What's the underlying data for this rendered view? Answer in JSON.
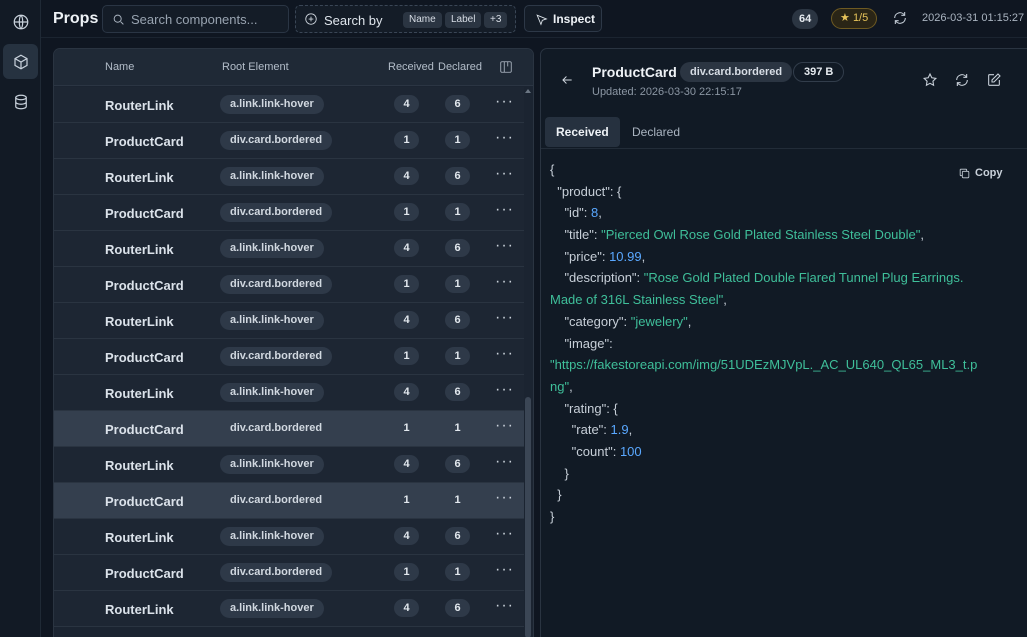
{
  "app": {
    "title": "Props"
  },
  "search": {
    "placeholder": "Search components...",
    "value": ""
  },
  "search_by": {
    "label": "Search by",
    "chips": [
      "Name",
      "Label",
      "+3"
    ]
  },
  "inspect": {
    "label": "Inspect"
  },
  "status": {
    "count": "64",
    "rating": "1/5",
    "timestamp": "2026-03-31 01:15:27"
  },
  "rail": {
    "icons": [
      "globe-icon",
      "cube-icon",
      "database-icon"
    ],
    "active": "cube-icon"
  },
  "table": {
    "headers": {
      "name": "Name",
      "root": "Root Element",
      "received": "Received",
      "declared": "Declared"
    },
    "rows": [
      {
        "name": "RouterLink",
        "root": "a.link.link-hover",
        "received": "4",
        "declared": "6",
        "highlighted": false
      },
      {
        "name": "ProductCard",
        "root": "div.card.bordered",
        "received": "1",
        "declared": "1",
        "highlighted": false
      },
      {
        "name": "RouterLink",
        "root": "a.link.link-hover",
        "received": "4",
        "declared": "6",
        "highlighted": false
      },
      {
        "name": "ProductCard",
        "root": "div.card.bordered",
        "received": "1",
        "declared": "1",
        "highlighted": false
      },
      {
        "name": "RouterLink",
        "root": "a.link.link-hover",
        "received": "4",
        "declared": "6",
        "highlighted": false
      },
      {
        "name": "ProductCard",
        "root": "div.card.bordered",
        "received": "1",
        "declared": "1",
        "highlighted": false
      },
      {
        "name": "RouterLink",
        "root": "a.link.link-hover",
        "received": "4",
        "declared": "6",
        "highlighted": false
      },
      {
        "name": "ProductCard",
        "root": "div.card.bordered",
        "received": "1",
        "declared": "1",
        "highlighted": false
      },
      {
        "name": "RouterLink",
        "root": "a.link.link-hover",
        "received": "4",
        "declared": "6",
        "highlighted": false
      },
      {
        "name": "ProductCard",
        "root": "div.card.bordered",
        "received": "1",
        "declared": "1",
        "highlighted": true
      },
      {
        "name": "RouterLink",
        "root": "a.link.link-hover",
        "received": "4",
        "declared": "6",
        "highlighted": false
      },
      {
        "name": "ProductCard",
        "root": "div.card.bordered",
        "received": "1",
        "declared": "1",
        "highlighted": true
      },
      {
        "name": "RouterLink",
        "root": "a.link.link-hover",
        "received": "4",
        "declared": "6",
        "highlighted": false
      },
      {
        "name": "ProductCard",
        "root": "div.card.bordered",
        "received": "1",
        "declared": "1",
        "highlighted": false
      },
      {
        "name": "RouterLink",
        "root": "a.link.link-hover",
        "received": "4",
        "declared": "6",
        "highlighted": false
      }
    ]
  },
  "detail": {
    "title": "ProductCard",
    "root": "div.card.bordered",
    "size": "397 B",
    "updated": "Updated: 2026-03-30 22:15:17",
    "tabs": [
      "Received",
      "Declared"
    ],
    "active_tab": "Received",
    "copy_label": "Copy",
    "json_lines": [
      [
        {
          "t": "p",
          "v": "{"
        }
      ],
      [
        {
          "t": "p",
          "v": "  \"product\": {"
        }
      ],
      [
        {
          "t": "p",
          "v": "    \"id\": "
        },
        {
          "t": "n",
          "v": "8"
        },
        {
          "t": "p",
          "v": ","
        }
      ],
      [
        {
          "t": "p",
          "v": "    \"title\": "
        },
        {
          "t": "s",
          "v": "\"Pierced Owl Rose Gold Plated Stainless Steel Double\""
        },
        {
          "t": "p",
          "v": ","
        }
      ],
      [
        {
          "t": "p",
          "v": "    \"price\": "
        },
        {
          "t": "n",
          "v": "10.99"
        },
        {
          "t": "p",
          "v": ","
        }
      ],
      [
        {
          "t": "p",
          "v": "    \"description\": "
        },
        {
          "t": "s",
          "v": "\"Rose Gold Plated Double Flared Tunnel Plug Earrings."
        }
      ],
      [
        {
          "t": "s",
          "v": "Made of 316L Stainless Steel\""
        },
        {
          "t": "p",
          "v": ","
        }
      ],
      [
        {
          "t": "p",
          "v": "    \"category\": "
        },
        {
          "t": "s",
          "v": "\"jewelery\""
        },
        {
          "t": "p",
          "v": ","
        }
      ],
      [
        {
          "t": "p",
          "v": "    \"image\":"
        }
      ],
      [
        {
          "t": "s",
          "v": "\"https://fakestoreapi.com/img/51UDEzMJVpL._AC_UL640_QL65_ML3_t.p"
        }
      ],
      [
        {
          "t": "s",
          "v": "ng\""
        },
        {
          "t": "p",
          "v": ","
        }
      ],
      [
        {
          "t": "p",
          "v": "    \"rating\": {"
        }
      ],
      [
        {
          "t": "p",
          "v": "      \"rate\": "
        },
        {
          "t": "n",
          "v": "1.9"
        },
        {
          "t": "p",
          "v": ","
        }
      ],
      [
        {
          "t": "p",
          "v": "      \"count\": "
        },
        {
          "t": "n",
          "v": "100"
        }
      ],
      [
        {
          "t": "p",
          "v": "    }"
        }
      ],
      [
        {
          "t": "p",
          "v": "  }"
        }
      ],
      [
        {
          "t": "p",
          "v": "}"
        }
      ]
    ]
  },
  "colors": {
    "string": "#3fbf9a",
    "number": "#5aa8ff",
    "star": "#e6c35a",
    "background": "#0f1621"
  }
}
